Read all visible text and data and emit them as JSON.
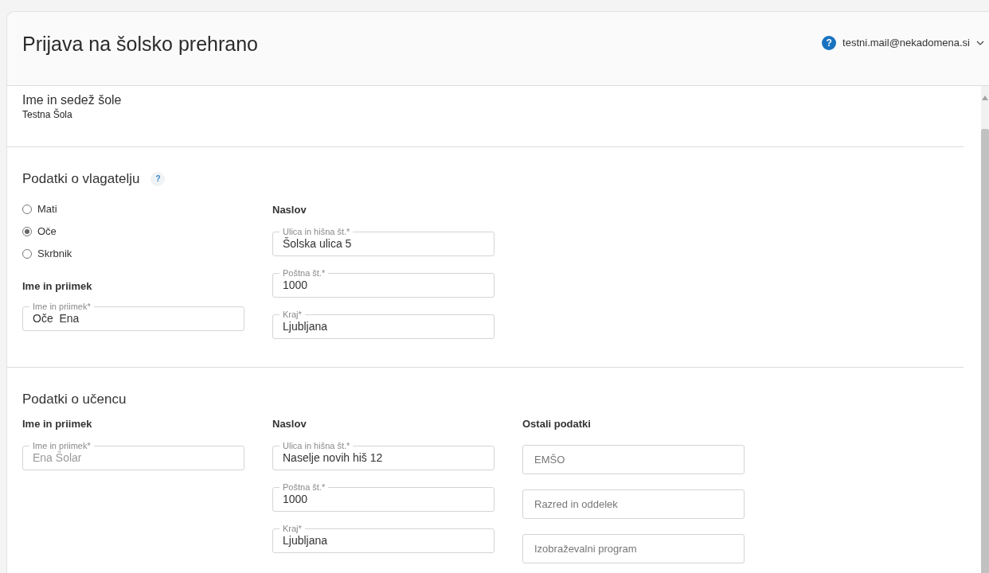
{
  "header": {
    "title": "Prijava na šolsko prehrano",
    "help": "?",
    "email": "testni.mail@nekadomena.si"
  },
  "school": {
    "label": "Ime in sedež šole",
    "value": "Testna Šola"
  },
  "applicant": {
    "title": "Podatki o vlagatelju",
    "help": "?",
    "relation": [
      {
        "label": "Mati",
        "selected": false
      },
      {
        "label": "Oče",
        "selected": true
      },
      {
        "label": "Skrbnik",
        "selected": false
      }
    ],
    "name_heading": "Ime in priimek",
    "name_field": {
      "label": "Ime in priimek*",
      "value": "Oče  Ena",
      "disabled": false
    },
    "address_heading": "Naslov",
    "address_fields": [
      {
        "label": "Ulica in hišna št.*",
        "value": "Šolska ulica 5",
        "disabled": false
      },
      {
        "label": "Poštna št.*",
        "value": "1000",
        "disabled": false
      },
      {
        "label": "Kraj*",
        "value": "Ljubljana",
        "disabled": false
      }
    ]
  },
  "student": {
    "title": "Podatki o učencu",
    "name_heading": "Ime in priimek",
    "name_field": {
      "label": "Ime in priimek*",
      "value": "Ena Šolar",
      "disabled": true
    },
    "address_heading": "Naslov",
    "address_fields": [
      {
        "label": "Ulica in hišna št.*",
        "value": "Naselje novih hiš 12",
        "disabled": false
      },
      {
        "label": "Poštna št.*",
        "value": "1000",
        "disabled": false
      },
      {
        "label": "Kraj*",
        "value": "Ljubljana",
        "disabled": false
      }
    ],
    "other_heading": "Ostali podatki",
    "other_fields": [
      {
        "placeholder": "EMŠO"
      },
      {
        "placeholder": "Razred in oddelek"
      },
      {
        "placeholder": "Izobraževalni program"
      }
    ]
  }
}
